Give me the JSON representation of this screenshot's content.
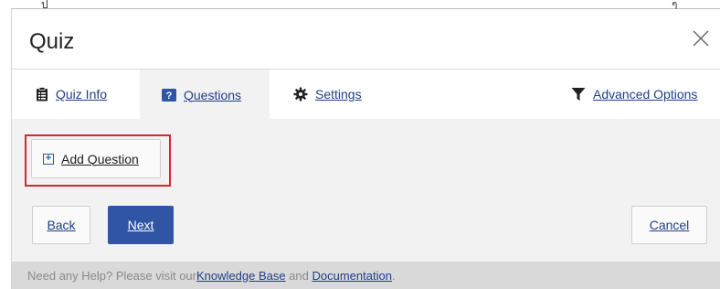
{
  "dialog": {
    "title": "Quiz"
  },
  "tabs": [
    {
      "label": "Quiz Info",
      "icon": "clipboard-icon"
    },
    {
      "label": "Questions",
      "icon": "question-box-icon",
      "active": true
    },
    {
      "label": "Settings",
      "icon": "gear-icon"
    },
    {
      "label": "Advanced Options",
      "icon": "filter-icon"
    }
  ],
  "content": {
    "add_question_label": "Add Question"
  },
  "nav": {
    "back_label": "Back",
    "next_label": "Next",
    "cancel_label": "Cancel"
  },
  "footer": {
    "text_before": "Need any Help? Please visit our ",
    "link1": "Knowledge Base",
    "text_mid": " and ",
    "link2": "Documentation",
    "text_after": "."
  },
  "colors": {
    "accent": "#2f55a4",
    "link": "#1f3f85",
    "highlight": "#d9262c",
    "panel_bg": "#f2f2f2"
  }
}
